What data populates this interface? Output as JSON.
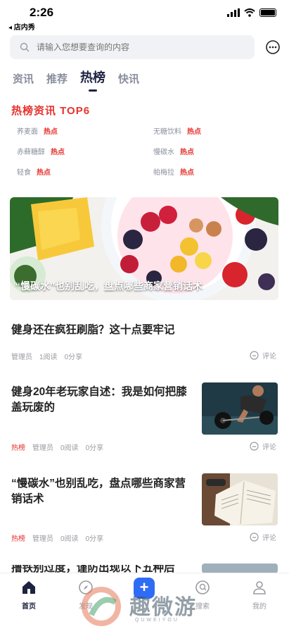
{
  "status": {
    "time": "2:26",
    "back_label": "◂ 店内秀"
  },
  "search": {
    "placeholder": "请输入您想要查询的内容"
  },
  "tabs": [
    {
      "label": "资讯",
      "active": false
    },
    {
      "label": "推荐",
      "active": false
    },
    {
      "label": "热榜",
      "active": true
    },
    {
      "label": "快讯",
      "active": false
    }
  ],
  "hot_section": {
    "title": "热榜资讯  TOP6",
    "tag": "热点",
    "items": [
      "荞麦面",
      "无糖饮料",
      "赤藓糖醇",
      "慢碳水",
      "轻食",
      "帕梅拉"
    ]
  },
  "banner": {
    "caption": "“慢碳水”也别乱吃，盘点哪些商家营销话术"
  },
  "articles": [
    {
      "title": "健身还在疯狂刷脂？这十点要牢记",
      "hot": "",
      "author": "管理员",
      "reads": "1阅读",
      "shares": "0分享",
      "comment": "评论"
    },
    {
      "title": "健身20年老玩家自述：我是如何把膝盖玩废的",
      "hot": "热榜",
      "author": "管理员",
      "reads": "0阅读",
      "shares": "0分享",
      "comment": "评论"
    },
    {
      "title": "“慢碳水”也别乱吃，盘点哪些商家营销话术",
      "hot": "热榜",
      "author": "管理员",
      "reads": "0阅读",
      "shares": "0分享",
      "comment": "评论"
    },
    {
      "title": "撸铁别过度，谨防出现以下五种后",
      "hot": "",
      "author": "",
      "reads": "",
      "shares": "",
      "comment": ""
    }
  ],
  "tabbar": [
    {
      "label": "首页",
      "icon": "home-icon",
      "active": true
    },
    {
      "label": "发现",
      "icon": "compass-icon",
      "active": false
    },
    {
      "label": "",
      "icon": "plus-icon",
      "active": false
    },
    {
      "label": "搜索",
      "icon": "search-icon",
      "active": false
    },
    {
      "label": "我的",
      "icon": "profile-icon",
      "active": false
    }
  ],
  "watermark": {
    "text": "趣微游",
    "sub": "QUWEIYOU"
  },
  "colors": {
    "accent_red": "#e6322d",
    "primary_navy": "#1d2340",
    "blue_button": "#2f6cf6"
  }
}
